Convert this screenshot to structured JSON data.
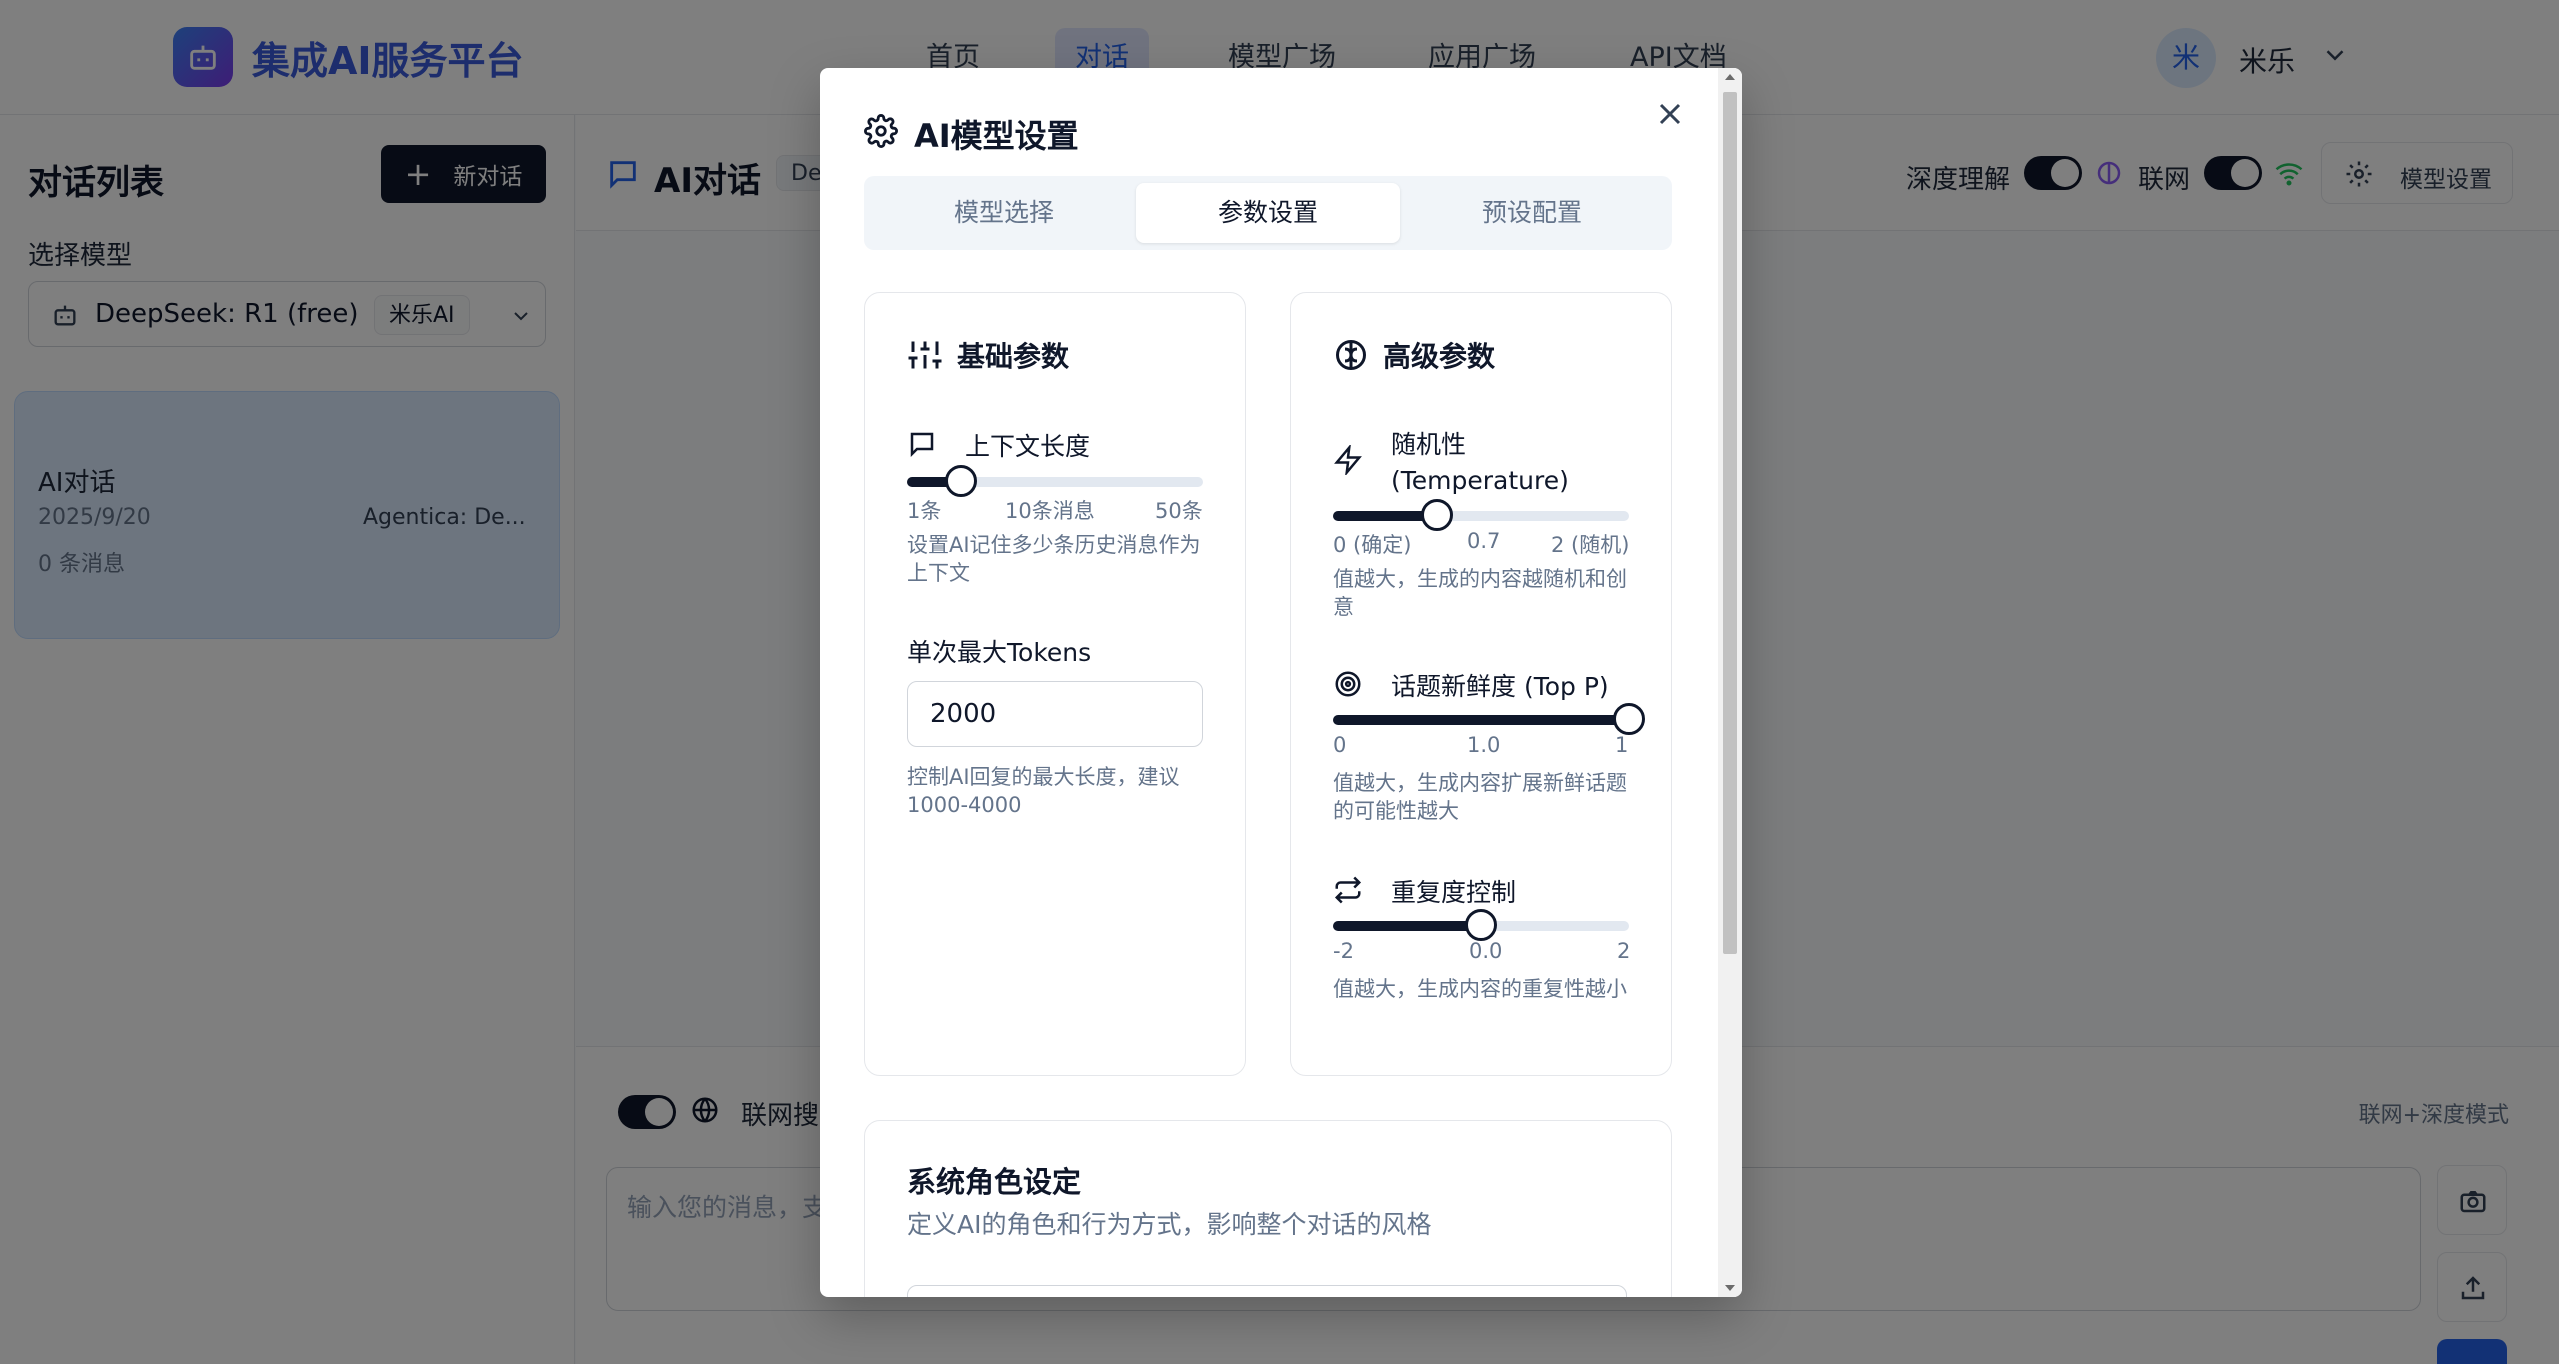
{
  "app": {
    "title": "集成AI服务平台",
    "nav": [
      {
        "label": "首页"
      },
      {
        "label": "对话"
      },
      {
        "label": "模型广场"
      },
      {
        "label": "应用广场"
      },
      {
        "label": "API文档"
      }
    ],
    "user": {
      "avatar_char": "米",
      "name": "米乐"
    }
  },
  "sidebar": {
    "title": "对话列表",
    "new_chat": "新对话",
    "select_model_label": "选择模型",
    "model": {
      "name": "DeepSeek: R1 (free)",
      "provider": "米乐AI"
    },
    "conversation": {
      "title": "AI对话",
      "date": "2025/9/20",
      "model": "Agentica: De...",
      "count": "0 条消息"
    }
  },
  "header": {
    "title": "AI对话",
    "badge": "De",
    "deep_label": "深度理解",
    "net_label": "联网",
    "model_settings": "模型设置"
  },
  "input": {
    "search_label": "联网搜",
    "mode": "联网+深度模式",
    "placeholder": "输入您的消息，支"
  },
  "modal": {
    "title": "AI模型设置",
    "tabs": [
      "模型选择",
      "参数设置",
      "预设配置"
    ],
    "active_tab": 1,
    "basic": {
      "title": "基础参数",
      "context": {
        "label": "上下文长度",
        "value": 10,
        "min": 1,
        "max": 50,
        "scale": [
          "1条",
          "10条消息",
          "50条"
        ],
        "desc": "设置AI记住多少条历史消息作为上下文"
      },
      "tokens": {
        "label": "单次最大Tokens",
        "value": "2000",
        "desc": "控制AI回复的最大长度，建议1000-4000"
      }
    },
    "advanced": {
      "title": "高级参数",
      "temperature": {
        "label": "随机性 (Temperature)",
        "value": 0.7,
        "min": 0,
        "max": 2,
        "scale": [
          "0 (确定)",
          "0.7",
          "2 (随机)"
        ],
        "desc": "值越大，生成的内容越随机和创意"
      },
      "top_p": {
        "label": "话题新鲜度 (Top P)",
        "value": 1.0,
        "min": 0,
        "max": 1,
        "scale": [
          "0",
          "1.0",
          "1"
        ],
        "desc": "值越大，生成内容扩展新鲜话题的可能性越大"
      },
      "penalty": {
        "label": "重复度控制",
        "value": 0.0,
        "min": -2,
        "max": 2,
        "scale": [
          "-2",
          "0.0",
          "2"
        ],
        "desc": "值越大，生成内容的重复性越小"
      }
    },
    "system": {
      "title": "系统角色设定",
      "subtitle": "定义AI的角色和行为方式，影响整个对话的风格"
    }
  },
  "colors": {
    "accent": "#2563eb",
    "dark": "#0f172a",
    "muted": "#64748b"
  }
}
